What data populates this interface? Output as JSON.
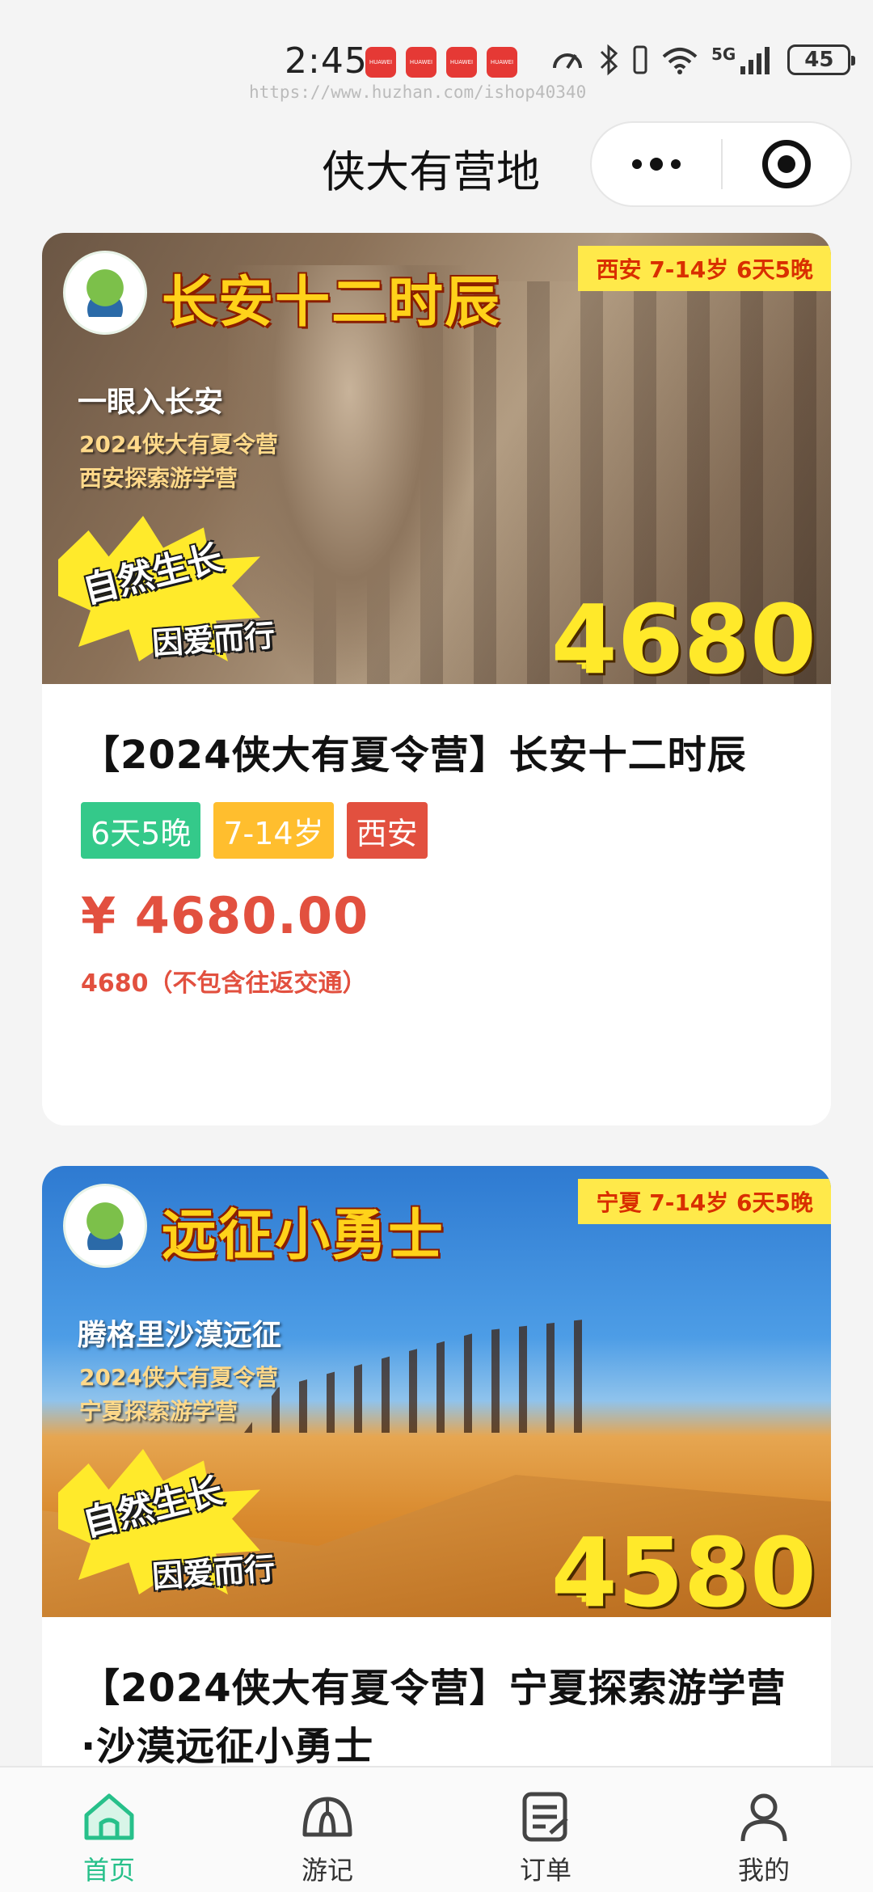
{
  "status_bar": {
    "time": "2:45",
    "notification_labels": [
      "HUAWEI",
      "HUAWEI",
      "HUAWEI",
      "HUAWEI"
    ],
    "network": "5G",
    "battery": "45",
    "watermark_url": "https://www.huzhan.com/ishop40340"
  },
  "nav": {
    "title": "侠大有营地",
    "more_icon": "more-dots-icon",
    "close_icon": "target-circle-icon"
  },
  "cards": [
    {
      "banner": {
        "title": "长安十二时辰",
        "tag": "西安 7-14岁 6天5晚",
        "sub1": "一眼入长安",
        "sub2": "2024侠大有夏令营",
        "sub3": "西安探索游学营",
        "slogan1": "自然生长",
        "slogan2": "因爱而行",
        "yen": "¥",
        "price": "4680"
      },
      "title": "【2024侠大有夏令营】长安十二时辰",
      "tags": [
        "6天5晚",
        "7-14岁",
        "西安"
      ],
      "price": "¥ 4680.00",
      "note": "4680（不包含往返交通）"
    },
    {
      "banner": {
        "title": "远征小勇士",
        "tag": "宁夏 7-14岁 6天5晚",
        "sub1": "腾格里沙漠远征",
        "sub2": "2024侠大有夏令营",
        "sub3": "宁夏探索游学营",
        "slogan1": "自然生长",
        "slogan2": "因爱而行",
        "yen": "¥",
        "price": "4580"
      },
      "title": "【2024侠大有夏令营】宁夏探索游学营·沙漠远征小勇士"
    }
  ],
  "tabbar": {
    "items": [
      {
        "label": "首页",
        "icon": "home-icon",
        "active": true
      },
      {
        "label": "游记",
        "icon": "dome-icon",
        "active": false
      },
      {
        "label": "订单",
        "icon": "order-list-icon",
        "active": false
      },
      {
        "label": "我的",
        "icon": "user-icon",
        "active": false
      }
    ],
    "active_color": "#27c08a"
  },
  "colors": {
    "price_red": "#e2503f",
    "tag_green": "#34c98a",
    "tag_orange": "#ffbe2e",
    "tag_red": "#e2503f",
    "banner_yellow": "#ffe92a"
  }
}
